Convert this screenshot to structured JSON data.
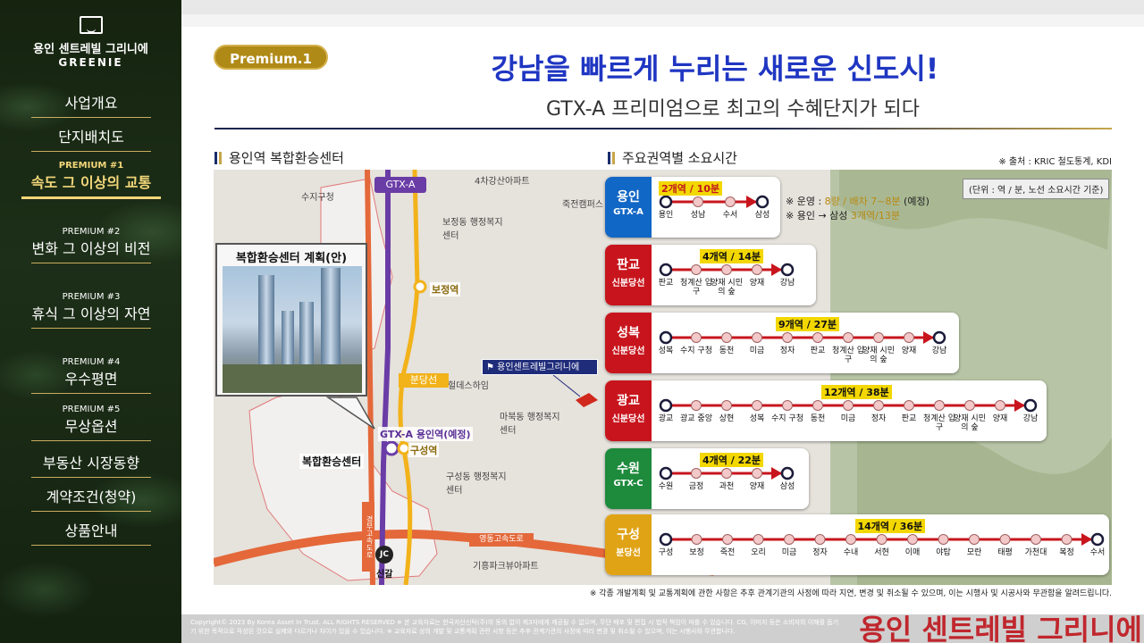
{
  "sidebar": {
    "brand": "용인 센트레빌 그리니에",
    "brand_en": "GREENIE",
    "items": [
      {
        "label": "사업개요"
      },
      {
        "label": "단지배치도"
      },
      {
        "pre": "PREMIUM #1",
        "label": "속도 그 이상의 교통"
      },
      {
        "pre": "PREMIUM #2",
        "label": "변화 그 이상의 비전"
      },
      {
        "pre": "PREMIUM #3",
        "label": "휴식 그 이상의 자연"
      },
      {
        "pre": "PREMIUM #4",
        "label": "우수평면"
      },
      {
        "pre": "PREMIUM #5",
        "label": "무상옵션"
      },
      {
        "label": "부동산 시장동향"
      },
      {
        "label": "계약조건(청약)"
      },
      {
        "label": "상품안내"
      }
    ]
  },
  "header": {
    "badge": "Premium.1",
    "title": "강남을 빠르게 누리는 새로운 신도시!",
    "subtitle": "GTX-A 프리미엄으로 최고의 수혜단지가 되다"
  },
  "left_section": {
    "heading": "용인역 복합환승센터",
    "inset_title": "복합환승센터 계획(안)",
    "gtx_tag": "GTX-A",
    "bundang_tag": "분당선",
    "site_tag": "용인센트레빌그리니에",
    "station_gtx": "GTX-A 용인역(예정)",
    "station_guseong": "구성역",
    "station_bojeong": "보정역",
    "transfer_label": "복합환승센터",
    "jc_label": "JC",
    "singal": "신갈",
    "road_tag": "영동고속도로",
    "road_v": "경부고속도로",
    "map_labels": [
      "수지구청",
      "보정동 행정복지센터",
      "마북동 행정복지센터",
      "구성동 행정복지센터",
      "헐데스하임",
      "죽전캠퍼스",
      "4차강산아파트",
      "기흥파크뷰아파트"
    ]
  },
  "right_section": {
    "heading": "주요권역별 소요시간",
    "source": "※ 출처 : KRIC 철도통계, KDI",
    "unit_note": "(단위 : 역 / 분, 노선 소요시간 기준)",
    "op_note_1": "※ 운영 : ",
    "op_note_1b": "8량 / 배차 7~8분",
    "op_note_1c": " (예정)",
    "op_note_2": "※ 용인 → 삼성 ",
    "op_note_2b": "3개역/13분",
    "routes": [
      {
        "name": "용인",
        "line": "GTX-A",
        "color": "#1167c5",
        "summary": "2개역 / 10분",
        "stations": [
          "용인",
          "성남",
          "수서",
          "삼성"
        ]
      },
      {
        "name": "판교",
        "line": "신분당선",
        "color": "#c8151d",
        "summary": "4개역 / 14분",
        "stations": [
          "판교",
          "청계산 입구",
          "양재 시민의 숲",
          "양재",
          "강남"
        ]
      },
      {
        "name": "성복",
        "line": "신분당선",
        "color": "#c8151d",
        "summary": "9개역 / 27분",
        "stations": [
          "성복",
          "수지 구청",
          "동천",
          "미금",
          "정자",
          "판교",
          "청계산 입구",
          "양재 시민의 숲",
          "양재",
          "강남"
        ]
      },
      {
        "name": "광교",
        "line": "신분당선",
        "color": "#c8151d",
        "summary": "12개역 / 38분",
        "stations": [
          "광교",
          "광교 중앙",
          "상현",
          "성복",
          "수지 구청",
          "동천",
          "미금",
          "정자",
          "판교",
          "청계산 입구",
          "양재 시민의 숲",
          "양재",
          "강남"
        ]
      },
      {
        "name": "수원",
        "line": "GTX-C",
        "color": "#1d8a3c",
        "summary": "4개역 / 22분",
        "stations": [
          "수원",
          "금정",
          "과천",
          "양재",
          "삼성"
        ]
      },
      {
        "name": "구성",
        "line": "분당선",
        "color": "#e0a316",
        "summary": "14개역 / 36분",
        "stations": [
          "구성",
          "보정",
          "죽전",
          "오리",
          "미금",
          "정자",
          "수내",
          "서현",
          "이매",
          "야탑",
          "모란",
          "태평",
          "가천대",
          "복정",
          "수서"
        ]
      }
    ]
  },
  "disclaimer": "※ 각종 개발계획 및 교통계획에 관한 사항은 추후 관계기관의 사정에 따라 지연, 변경 및 취소될 수 있으며, 이는 시행사 및 시공사와 무관함을 알려드립니다.",
  "footer": {
    "copy1": "Copyright© 2023 By Korea Asset In Trust. ALL RIGHTS RESERVED   ※ 본 교육자료는 한국자산신탁(주)의 동의 없이 제3자에게 제공될 수 없으며, 무단 배포 및 편집 시 법적 책임이 따를 수 있습니다. CG, 이미지 등은 소비자의 이해를 돕기",
    "copy2": "기 위한 목적으로 작성된 것으로 실제와 다르거나 차이가 있을 수 있습니다. ※ 교육자료 상의 개발 및 교통계획 관련 사항 등은 추후 관계기관의 사정에 따라 변경 및 취소될 수 있으며, 이는 시행사와 무관합니다.",
    "brand": "용인 센트레빌 그리니에"
  }
}
